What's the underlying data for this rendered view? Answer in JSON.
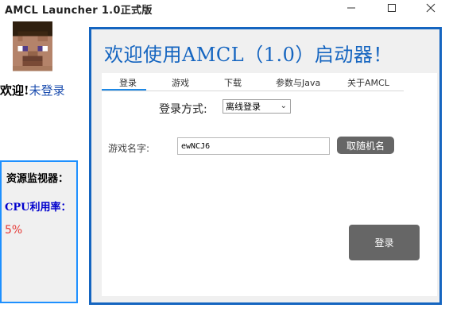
{
  "window": {
    "title": "AMCL  Launcher 1.0正式版",
    "minimize_icon": "minimize-icon",
    "maximize_icon": "maximize-icon",
    "close_icon": "close-icon"
  },
  "sidebar": {
    "avatar_icon": "steve-avatar-icon",
    "welcome_text": "欢迎!",
    "login_link": "未登录",
    "monitor": {
      "title": "资源监视器：",
      "cpu_label": "CPU利用率：",
      "cpu_value": "5%"
    }
  },
  "main": {
    "title": "欢迎使用AMCL（1.0）启动器！",
    "tabs": [
      {
        "label": "登录"
      },
      {
        "label": "游戏"
      },
      {
        "label": "下载"
      },
      {
        "label": "参数与Java"
      },
      {
        "label": "关于AMCL"
      }
    ],
    "login_method_label": "登录方式:",
    "login_method_selected": "离线登录",
    "game_name_label": "游戏名字:",
    "game_name_value": "ewNCJ6",
    "random_name_button": "取随机名",
    "login_button": "登录"
  },
  "colors": {
    "accent": "#1565c0",
    "monitor_border": "#1e90ff",
    "cpu_label": "#0000cd",
    "cpu_value": "#e53935",
    "button_bg": "#666666"
  }
}
